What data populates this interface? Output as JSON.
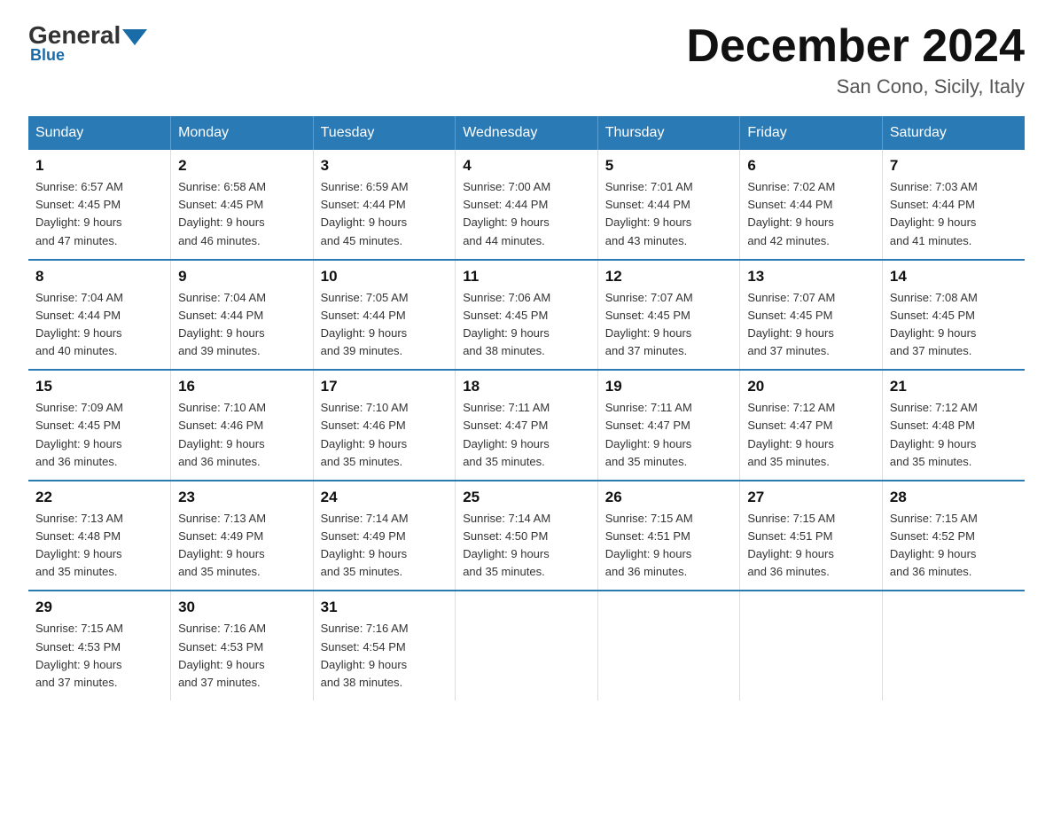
{
  "header": {
    "logo_general": "General",
    "logo_blue": "Blue",
    "month_title": "December 2024",
    "location": "San Cono, Sicily, Italy"
  },
  "weekdays": [
    "Sunday",
    "Monday",
    "Tuesday",
    "Wednesday",
    "Thursday",
    "Friday",
    "Saturday"
  ],
  "weeks": [
    [
      {
        "day": "1",
        "sunrise": "6:57 AM",
        "sunset": "4:45 PM",
        "daylight": "9 hours and 47 minutes."
      },
      {
        "day": "2",
        "sunrise": "6:58 AM",
        "sunset": "4:45 PM",
        "daylight": "9 hours and 46 minutes."
      },
      {
        "day": "3",
        "sunrise": "6:59 AM",
        "sunset": "4:44 PM",
        "daylight": "9 hours and 45 minutes."
      },
      {
        "day": "4",
        "sunrise": "7:00 AM",
        "sunset": "4:44 PM",
        "daylight": "9 hours and 44 minutes."
      },
      {
        "day": "5",
        "sunrise": "7:01 AM",
        "sunset": "4:44 PM",
        "daylight": "9 hours and 43 minutes."
      },
      {
        "day": "6",
        "sunrise": "7:02 AM",
        "sunset": "4:44 PM",
        "daylight": "9 hours and 42 minutes."
      },
      {
        "day": "7",
        "sunrise": "7:03 AM",
        "sunset": "4:44 PM",
        "daylight": "9 hours and 41 minutes."
      }
    ],
    [
      {
        "day": "8",
        "sunrise": "7:04 AM",
        "sunset": "4:44 PM",
        "daylight": "9 hours and 40 minutes."
      },
      {
        "day": "9",
        "sunrise": "7:04 AM",
        "sunset": "4:44 PM",
        "daylight": "9 hours and 39 minutes."
      },
      {
        "day": "10",
        "sunrise": "7:05 AM",
        "sunset": "4:44 PM",
        "daylight": "9 hours and 39 minutes."
      },
      {
        "day": "11",
        "sunrise": "7:06 AM",
        "sunset": "4:45 PM",
        "daylight": "9 hours and 38 minutes."
      },
      {
        "day": "12",
        "sunrise": "7:07 AM",
        "sunset": "4:45 PM",
        "daylight": "9 hours and 37 minutes."
      },
      {
        "day": "13",
        "sunrise": "7:07 AM",
        "sunset": "4:45 PM",
        "daylight": "9 hours and 37 minutes."
      },
      {
        "day": "14",
        "sunrise": "7:08 AM",
        "sunset": "4:45 PM",
        "daylight": "9 hours and 37 minutes."
      }
    ],
    [
      {
        "day": "15",
        "sunrise": "7:09 AM",
        "sunset": "4:45 PM",
        "daylight": "9 hours and 36 minutes."
      },
      {
        "day": "16",
        "sunrise": "7:10 AM",
        "sunset": "4:46 PM",
        "daylight": "9 hours and 36 minutes."
      },
      {
        "day": "17",
        "sunrise": "7:10 AM",
        "sunset": "4:46 PM",
        "daylight": "9 hours and 35 minutes."
      },
      {
        "day": "18",
        "sunrise": "7:11 AM",
        "sunset": "4:47 PM",
        "daylight": "9 hours and 35 minutes."
      },
      {
        "day": "19",
        "sunrise": "7:11 AM",
        "sunset": "4:47 PM",
        "daylight": "9 hours and 35 minutes."
      },
      {
        "day": "20",
        "sunrise": "7:12 AM",
        "sunset": "4:47 PM",
        "daylight": "9 hours and 35 minutes."
      },
      {
        "day": "21",
        "sunrise": "7:12 AM",
        "sunset": "4:48 PM",
        "daylight": "9 hours and 35 minutes."
      }
    ],
    [
      {
        "day": "22",
        "sunrise": "7:13 AM",
        "sunset": "4:48 PM",
        "daylight": "9 hours and 35 minutes."
      },
      {
        "day": "23",
        "sunrise": "7:13 AM",
        "sunset": "4:49 PM",
        "daylight": "9 hours and 35 minutes."
      },
      {
        "day": "24",
        "sunrise": "7:14 AM",
        "sunset": "4:49 PM",
        "daylight": "9 hours and 35 minutes."
      },
      {
        "day": "25",
        "sunrise": "7:14 AM",
        "sunset": "4:50 PM",
        "daylight": "9 hours and 35 minutes."
      },
      {
        "day": "26",
        "sunrise": "7:15 AM",
        "sunset": "4:51 PM",
        "daylight": "9 hours and 36 minutes."
      },
      {
        "day": "27",
        "sunrise": "7:15 AM",
        "sunset": "4:51 PM",
        "daylight": "9 hours and 36 minutes."
      },
      {
        "day": "28",
        "sunrise": "7:15 AM",
        "sunset": "4:52 PM",
        "daylight": "9 hours and 36 minutes."
      }
    ],
    [
      {
        "day": "29",
        "sunrise": "7:15 AM",
        "sunset": "4:53 PM",
        "daylight": "9 hours and 37 minutes."
      },
      {
        "day": "30",
        "sunrise": "7:16 AM",
        "sunset": "4:53 PM",
        "daylight": "9 hours and 37 minutes."
      },
      {
        "day": "31",
        "sunrise": "7:16 AM",
        "sunset": "4:54 PM",
        "daylight": "9 hours and 38 minutes."
      },
      null,
      null,
      null,
      null
    ]
  ],
  "labels": {
    "sunrise": "Sunrise:",
    "sunset": "Sunset:",
    "daylight": "Daylight:"
  }
}
